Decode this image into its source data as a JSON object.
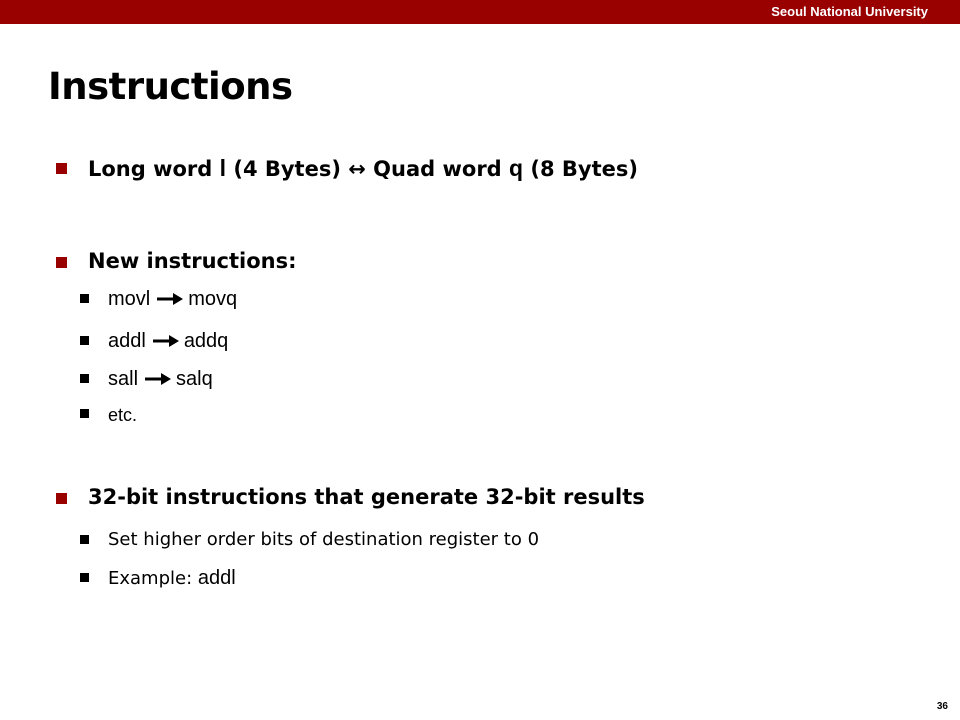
{
  "header": {
    "institution": "Seoul National University"
  },
  "slide": {
    "title": "Instructions",
    "page_number": "36"
  },
  "bullets": {
    "b1": {
      "part1": "Long word ",
      "l": "l",
      "part2": " (4 Bytes) ",
      "arrow": "↔",
      "part3": " Quad word ",
      "q": "q",
      "part4": " (8 Bytes)"
    },
    "b2": {
      "text": "New instructions:",
      "items": [
        {
          "from": "movl",
          "to": "movq"
        },
        {
          "from": "addl",
          "to": "addq"
        },
        {
          "from": "sall",
          "to": "salq"
        }
      ],
      "etc": "etc."
    },
    "b3": {
      "text": "32-bit instructions that generate 32-bit results",
      "sub1": "Set higher order bits of destination register to 0",
      "sub2_prefix": "Example: ",
      "sub2_code": "addl"
    }
  },
  "colors": {
    "accent": "#990000"
  }
}
